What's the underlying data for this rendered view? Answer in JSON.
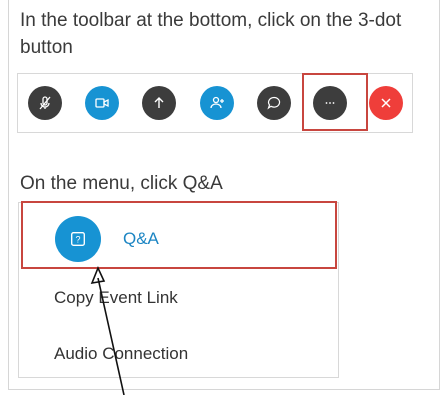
{
  "instruction_1": "In the toolbar at the bottom, click on the 3-dot button",
  "instruction_2": "On the menu, click Q&A",
  "toolbar": {
    "buttons": [
      {
        "name": "mute-button",
        "icon": "microphone-off-icon",
        "color": "#3d3d3d"
      },
      {
        "name": "video-button",
        "icon": "video-camera-icon",
        "color": "#1793d3"
      },
      {
        "name": "share-button",
        "icon": "upload-arrow-icon",
        "color": "#3d3d3d"
      },
      {
        "name": "participants-button",
        "icon": "add-person-icon",
        "color": "#1793d3"
      },
      {
        "name": "chat-button",
        "icon": "chat-bubble-icon",
        "color": "#3d3d3d"
      },
      {
        "name": "more-button",
        "icon": "more-dots-icon",
        "color": "#3d3d3d"
      },
      {
        "name": "leave-button",
        "icon": "close-x-icon",
        "color": "#ef3e3a"
      }
    ]
  },
  "menu": {
    "qa_label": "Q&A",
    "copy_label": "Copy Event Link",
    "audio_label": "Audio Connection"
  },
  "colors": {
    "highlight": "#c8463f",
    "accent_blue": "#1793d3",
    "dark_button": "#3d3d3d",
    "leave_red": "#ef3e3a"
  }
}
